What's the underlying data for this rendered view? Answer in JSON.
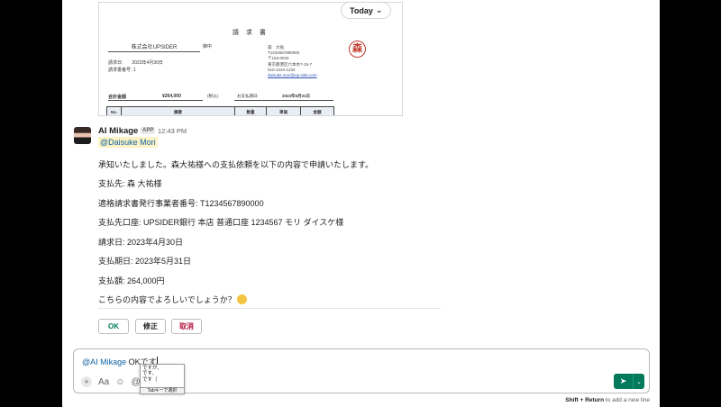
{
  "date_divider": {
    "label": "Today"
  },
  "invoice": {
    "title": "請 求 書",
    "company": "株式会社UPSIDER",
    "honorific": "御中",
    "date": "請求日:　　2023年4月30日",
    "number": "請求書番号: 1",
    "seal": "森",
    "issuer": [
      "森　大祐",
      "T1234567890000",
      "〒153-0042",
      "東京都港区六本木7-15-7",
      "010-1234-1234",
      "daisuke.mori@up-side.com"
    ],
    "amount_label": "合計金額",
    "amount": "¥264,000",
    "tax": "(税込)",
    "due_label": "お支払期日:",
    "due": "2023年5月31日",
    "columns": [
      "No.",
      "摘要",
      "数量",
      "単価",
      "金額"
    ]
  },
  "message": {
    "sender": "AI Mikage",
    "badge": "APP",
    "time": "12:43 PM",
    "mention": "@Daisuke Mori",
    "lines": [
      "承知いたしました。森大祐様への支払依頼を以下の内容で申請いたします。",
      "支払先: 森 大祐様",
      "適格請求書発行事業者番号: T1234567890000",
      "支払先口座: UPSIDER銀行 本店 普通口座 1234567 モリ ダイスケ様",
      "請求日: 2023年4月30日",
      "支払期日: 2023年5月31日",
      "支払額: 264,000円",
      "こちらの内容でよろしいでしょうか？"
    ],
    "buttons": {
      "ok": "OK",
      "fix": "修正",
      "cancel": "取消"
    }
  },
  "composer": {
    "mention": "@AI Mikage",
    "text_plain": " OK",
    "text_ime": "です",
    "ime_candidates": [
      "ですが、",
      "です、",
      "です（"
    ],
    "ime_hint": "Tabキーで選択",
    "tools": [
      "+",
      "Aa",
      "☺",
      "@"
    ]
  },
  "footer_hint": {
    "key": "Shift + Return",
    "text": " to add a new line"
  }
}
